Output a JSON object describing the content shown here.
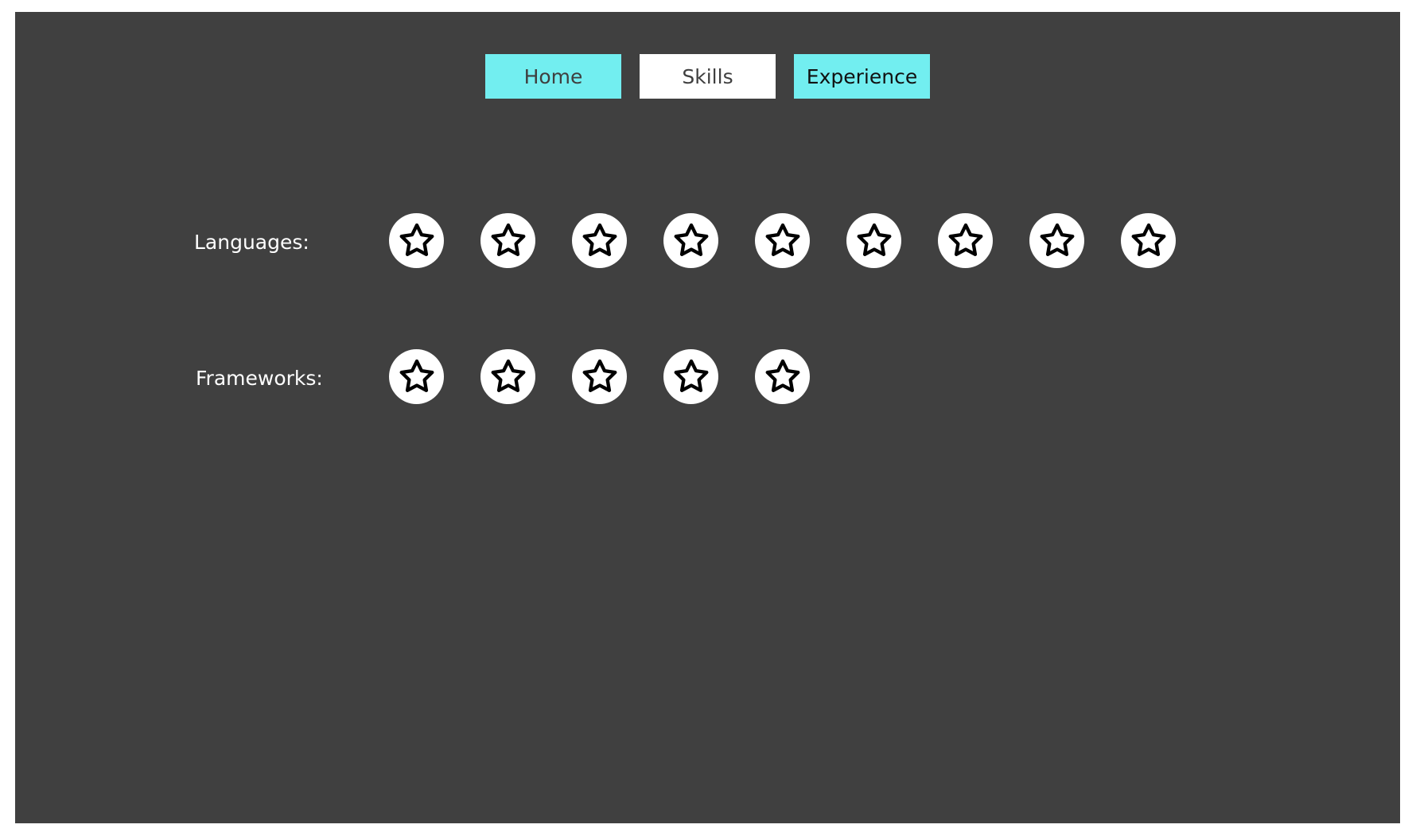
{
  "nav": {
    "home_label": "Home",
    "skills_label": "Skills",
    "experience_label": "Experience"
  },
  "skills": {
    "languages": {
      "label": "Languages:",
      "rating": 9,
      "icon": "star-icon"
    },
    "frameworks": {
      "label": "Frameworks:",
      "rating": 5,
      "icon": "star-icon"
    }
  },
  "colors": {
    "background": "#404040",
    "accent": "#72eef0",
    "button_neutral": "#ffffff",
    "text_light": "#ffffff"
  }
}
